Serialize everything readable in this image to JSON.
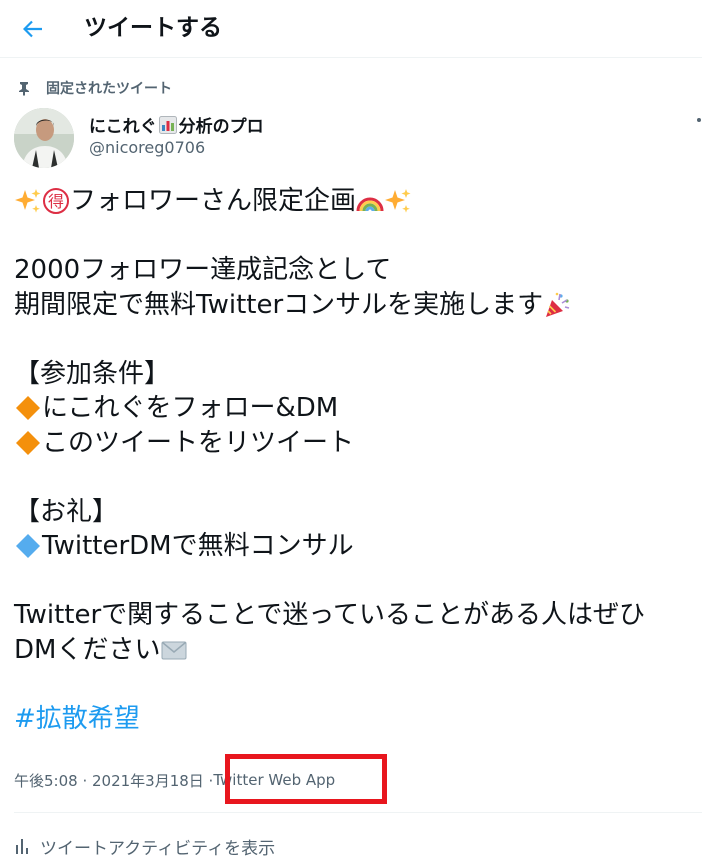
{
  "header": {
    "title": "ツイートする"
  },
  "pinned": {
    "label": "固定されたツイート"
  },
  "author": {
    "display_name_part1": "にこれぐ",
    "display_name_part2": "分析のプロ",
    "handle": "@nicoreg0706"
  },
  "tweet": {
    "line1": "フォロワーさん限定企画",
    "line2": "2000フォロワー達成記念として",
    "line3": "期間限定で無料Twitterコンサルを実施します",
    "line4": "【参加条件】",
    "line5": "にこれぐをフォロー&DM",
    "line6": "このツイートをリツイート",
    "line7": "【お礼】",
    "line8": "TwitterDMで無料コンサル",
    "line9": "Twitterで関することで迷っていることがある人はぜひ",
    "line10": "DMください",
    "hashtag": "#拡散希望"
  },
  "meta": {
    "timestamp": "午後5:08 · 2021年3月18日 · ",
    "app": "Twitter Web App"
  },
  "activity": {
    "label": "ツイートアクティビティを表示"
  },
  "colors": {
    "accent": "#1d9bf0",
    "highlight": "#e8161e",
    "secondary_text": "#536471"
  }
}
